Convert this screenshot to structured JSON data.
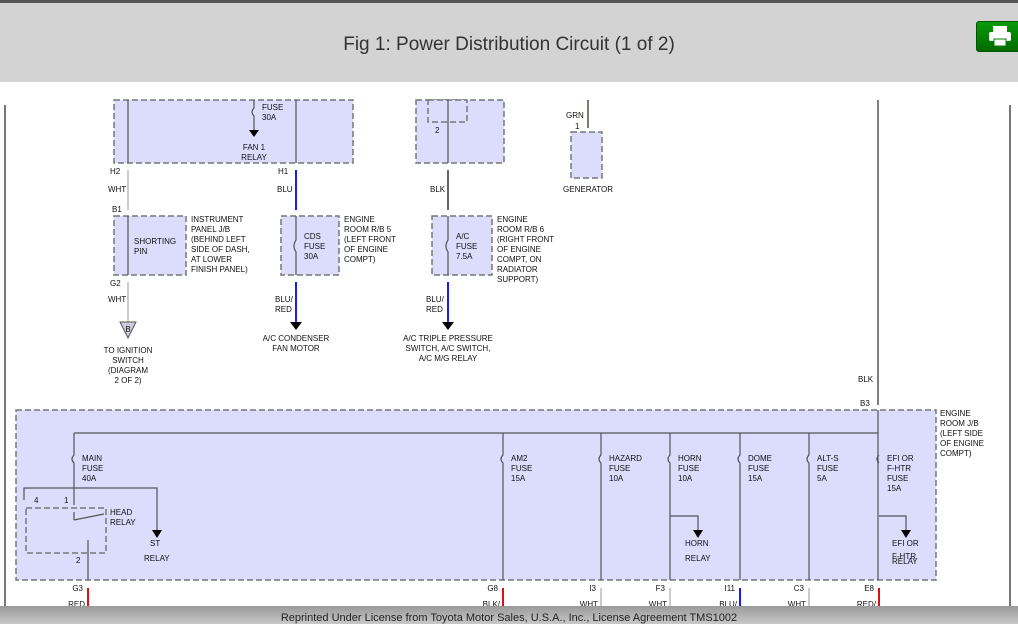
{
  "header": {
    "title": "Fig 1: Power Distribution Circuit (1 of 2)",
    "print_icon": "printer-icon"
  },
  "footer": {
    "text": "Reprinted Under License from Toyota Motor Sales, U.S.A., Inc., License Agreement TMS1002"
  },
  "colors": {
    "blu": "#1a1aff",
    "red": "#e01010",
    "wht": "#cccccc",
    "blk": "#555555",
    "grn": "#708070",
    "box": "#dcdcfc",
    "print": "#0a8a0a"
  },
  "diagram": {
    "fan_fuse": [
      "FUSE",
      "30A"
    ],
    "fan_relay": [
      "FAN 1",
      "RELAY"
    ],
    "h2": "H2",
    "h1": "H1",
    "wht1": "WHT",
    "blu1": "BLU",
    "blk1": "BLK",
    "b1": "B1",
    "g2": "G2",
    "wht2": "WHT",
    "shorting_pin": [
      "SHORTING",
      "PIN"
    ],
    "ip_jb": [
      "INSTRUMENT",
      "PANEL J/B",
      "(BEHIND LEFT",
      "SIDE OF DASH,",
      "AT LOWER",
      "FINISH PANEL)"
    ],
    "cds_fuse": [
      "CDS",
      "FUSE",
      "30A"
    ],
    "er_rb5": [
      "ENGINE",
      "ROOM R/B 5",
      "(LEFT FRONT",
      "OF ENGINE",
      "COMPT)"
    ],
    "ac_fuse": [
      "A/C",
      "FUSE",
      "7.5A"
    ],
    "er_rb6": [
      "ENGINE",
      "ROOM R/B 6",
      "(RIGHT FRONT",
      "OF ENGINE",
      "COMPT, ON",
      "RADIATOR",
      "SUPPORT)"
    ],
    "blured1": [
      "BLU/",
      "RED"
    ],
    "blured2": [
      "BLU/",
      "RED"
    ],
    "ign_connector": "B",
    "to_ignition": [
      "TO IGNITION",
      "SWITCH",
      "(DIAGRAM",
      "2 OF 2)"
    ],
    "ac_cond": [
      "A/C CONDENSER",
      "FAN MOTOR"
    ],
    "ac_triple": [
      "A/C TRIPLE PRESSURE",
      "SWITCH, A/C SWITCH,",
      "A/C M/G RELAY"
    ],
    "relay_pin2": "2",
    "grn": "GRN",
    "gen_pin": "1",
    "generator": "GENERATOR",
    "blk2": "BLK",
    "b3": "B3",
    "er_jb": [
      "ENGINE",
      "ROOM J/B",
      "(LEFT SIDE",
      "OF ENGINE",
      "COMPT)"
    ],
    "main_fuse": [
      "MAIN",
      "FUSE",
      "40A"
    ],
    "pin4": "4",
    "pin1": "1",
    "pin2": "2",
    "head_relay": [
      "HEAD",
      "RELAY"
    ],
    "st_relay": [
      "ST",
      "RELAY"
    ],
    "fuses": [
      [
        "AM2",
        "FUSE",
        "15A"
      ],
      [
        "HAZARD",
        "FUSE",
        "10A"
      ],
      [
        "HORN",
        "FUSE",
        "10A"
      ],
      [
        "DOME",
        "FUSE",
        "15A"
      ],
      [
        "ALT-S",
        "FUSE",
        "5A"
      ],
      [
        "EFI OR",
        "F-HTR",
        "FUSE",
        "15A"
      ]
    ],
    "horn_relay": [
      "HORN",
      "RELAY"
    ],
    "efi_relay": [
      "EFI OR",
      "F-HTR",
      "RELAY"
    ],
    "connectors": [
      "G3",
      "G8",
      "I3",
      "F3",
      "I11",
      "C3",
      "E8"
    ],
    "wire_colors": [
      "RED",
      "BLK/",
      "WHT",
      "WHT",
      "BLU/",
      "WHT",
      "RED/"
    ]
  }
}
